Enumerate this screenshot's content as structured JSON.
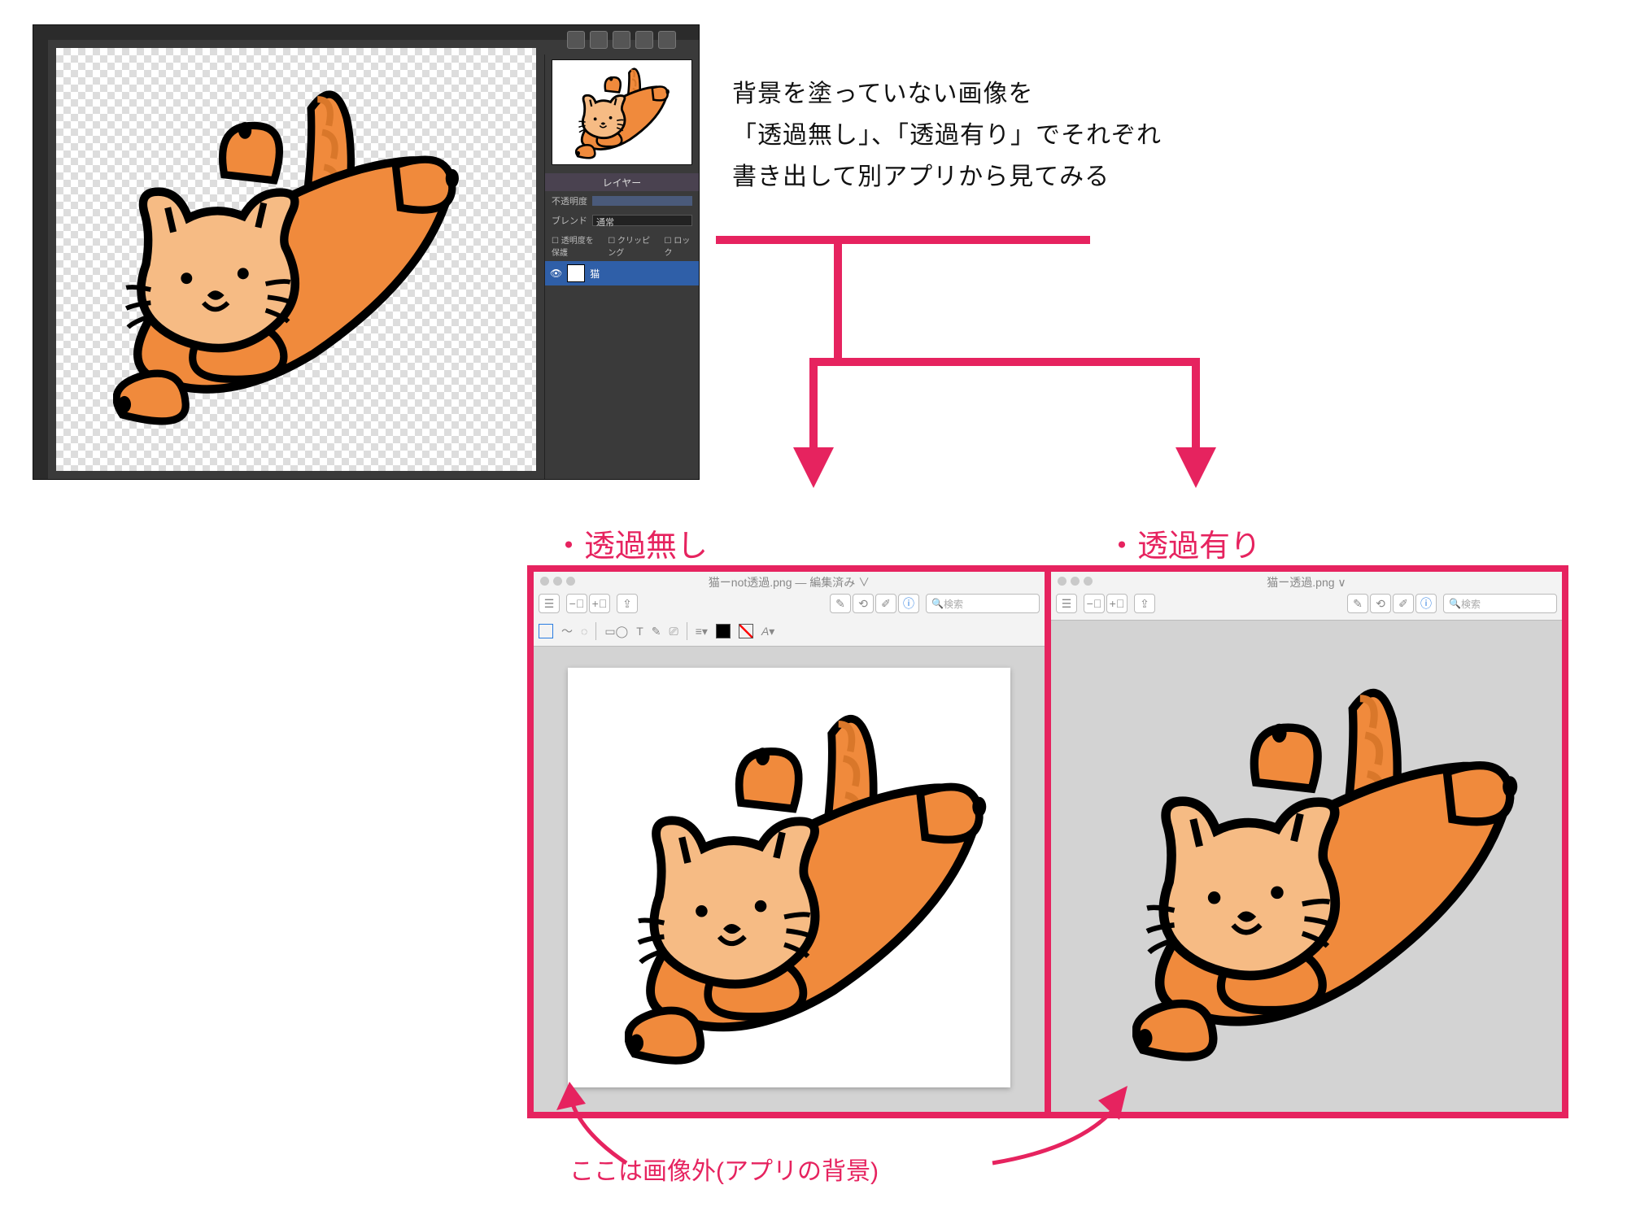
{
  "caption": {
    "line1": "背景を塗っていない画像を",
    "line2": "「透過無し」、「透過有り」でそれぞれ",
    "line3": "書き出して別アプリから見てみる"
  },
  "labels": {
    "no_trans": "・透過無し",
    "with_trans": "・透過有り"
  },
  "editor_panel": {
    "tab_layer": "レイヤー",
    "opacity_label": "不透明度",
    "blend_label": "ブレンド",
    "blend_value": "通常",
    "protect_label": "透明度を保護",
    "clipping_label": "クリッピング",
    "lock_label": "ロック",
    "layer_name": "猫"
  },
  "preview": {
    "left_title": "猫ーnot透過.png — 編集済み ∨",
    "right_title": "猫ー透過.png ∨",
    "search_placeholder": "検索",
    "toolbar_icons": [
      "sidebar",
      "zoom-out",
      "zoom-in",
      "share"
    ],
    "toolbar_icons_right": [
      "pencil",
      "rotate",
      "crop",
      "info"
    ],
    "markup_row_items": [
      "select",
      "line",
      "lasso",
      "shapes",
      "text",
      "sign",
      "fill",
      "stroke",
      "font"
    ]
  },
  "callout_text": "ここは画像外(アプリの背景)",
  "colors": {
    "accent": "#e6235f",
    "cat_body": "#f08a3c",
    "cat_light": "#f6bb84"
  }
}
